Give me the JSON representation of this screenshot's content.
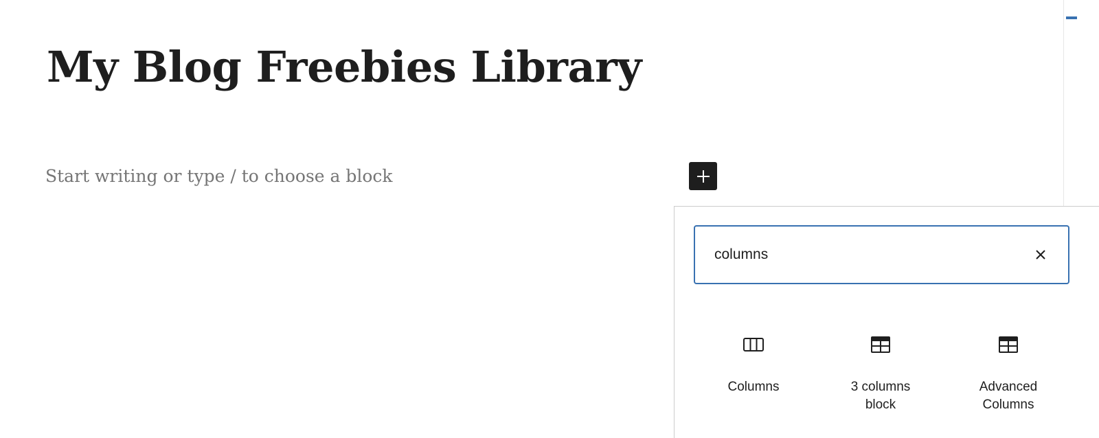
{
  "editor": {
    "post_title": "My Blog Freebies Library",
    "block_placeholder": "Start writing or type / to choose a block",
    "inserter_toggle_icon": "plus-icon"
  },
  "inserter": {
    "search": {
      "value": "columns",
      "clear_icon": "close-icon"
    },
    "results": [
      {
        "label": "Columns",
        "icon": "columns-block-icon"
      },
      {
        "label": "3 columns\nblock",
        "icon": "table-block-icon"
      },
      {
        "label": "Advanced\nColumns",
        "icon": "table-block-icon"
      }
    ]
  },
  "colors": {
    "accent": "#3871b1",
    "text": "#1e1e1e",
    "placeholder": "#757575",
    "border": "#cccccc"
  }
}
